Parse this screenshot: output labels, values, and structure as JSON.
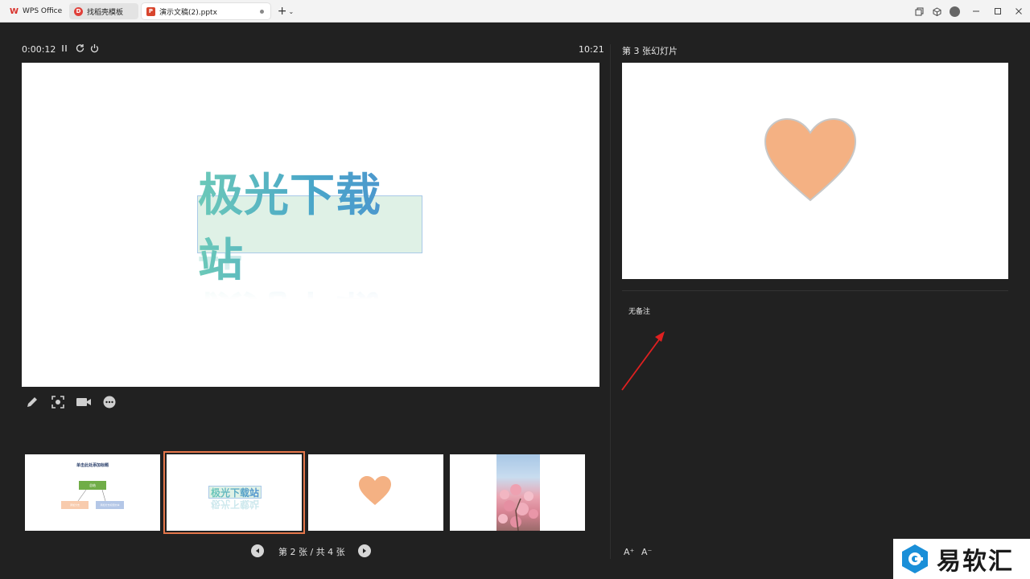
{
  "titlebar": {
    "tabs": [
      {
        "label": "WPS Office",
        "icon": "wps-logo-icon",
        "color": "#d8312b"
      },
      {
        "label": "找稻壳模板",
        "icon": "docer-icon",
        "color": "#e0403a"
      },
      {
        "label": "演示文稿(2).pptx",
        "icon": "presentation-file-icon",
        "color": "#d8452d"
      }
    ],
    "new_tab": "+",
    "window_controls": [
      "restore-window-icon",
      "cube-icon",
      "avatar",
      "minimize-icon",
      "maximize-icon",
      "close-icon"
    ]
  },
  "presenter": {
    "elapsed": "0:00:12",
    "clock": "10:21",
    "controls": [
      "pause-icon",
      "restart-icon",
      "power-icon"
    ],
    "tools": [
      "pen-icon",
      "focus-icon",
      "camera-icon",
      "more-icon"
    ],
    "current_slide": {
      "title_text": "极光下载站"
    }
  },
  "thumbnails": [
    {
      "id": 1,
      "title": "单击此处添加标题",
      "chart_root": "总结",
      "chart_left": "添加分支",
      "chart_right": "添加分支标题文本"
    },
    {
      "id": 2,
      "text": "极光下载站",
      "active": true
    },
    {
      "id": 3,
      "shape": "heart",
      "color": "#f4b183"
    },
    {
      "id": 4,
      "image": "cherry-blossom"
    }
  ],
  "pager": {
    "text": "第 2 张 / 共 4 张"
  },
  "next_pane": {
    "label": "第 3 张幻灯片",
    "heart_color": "#f4b183",
    "notes": "无备注",
    "font_up": "A⁺",
    "font_down": "A⁻"
  },
  "watermark": {
    "text": "易软汇"
  }
}
